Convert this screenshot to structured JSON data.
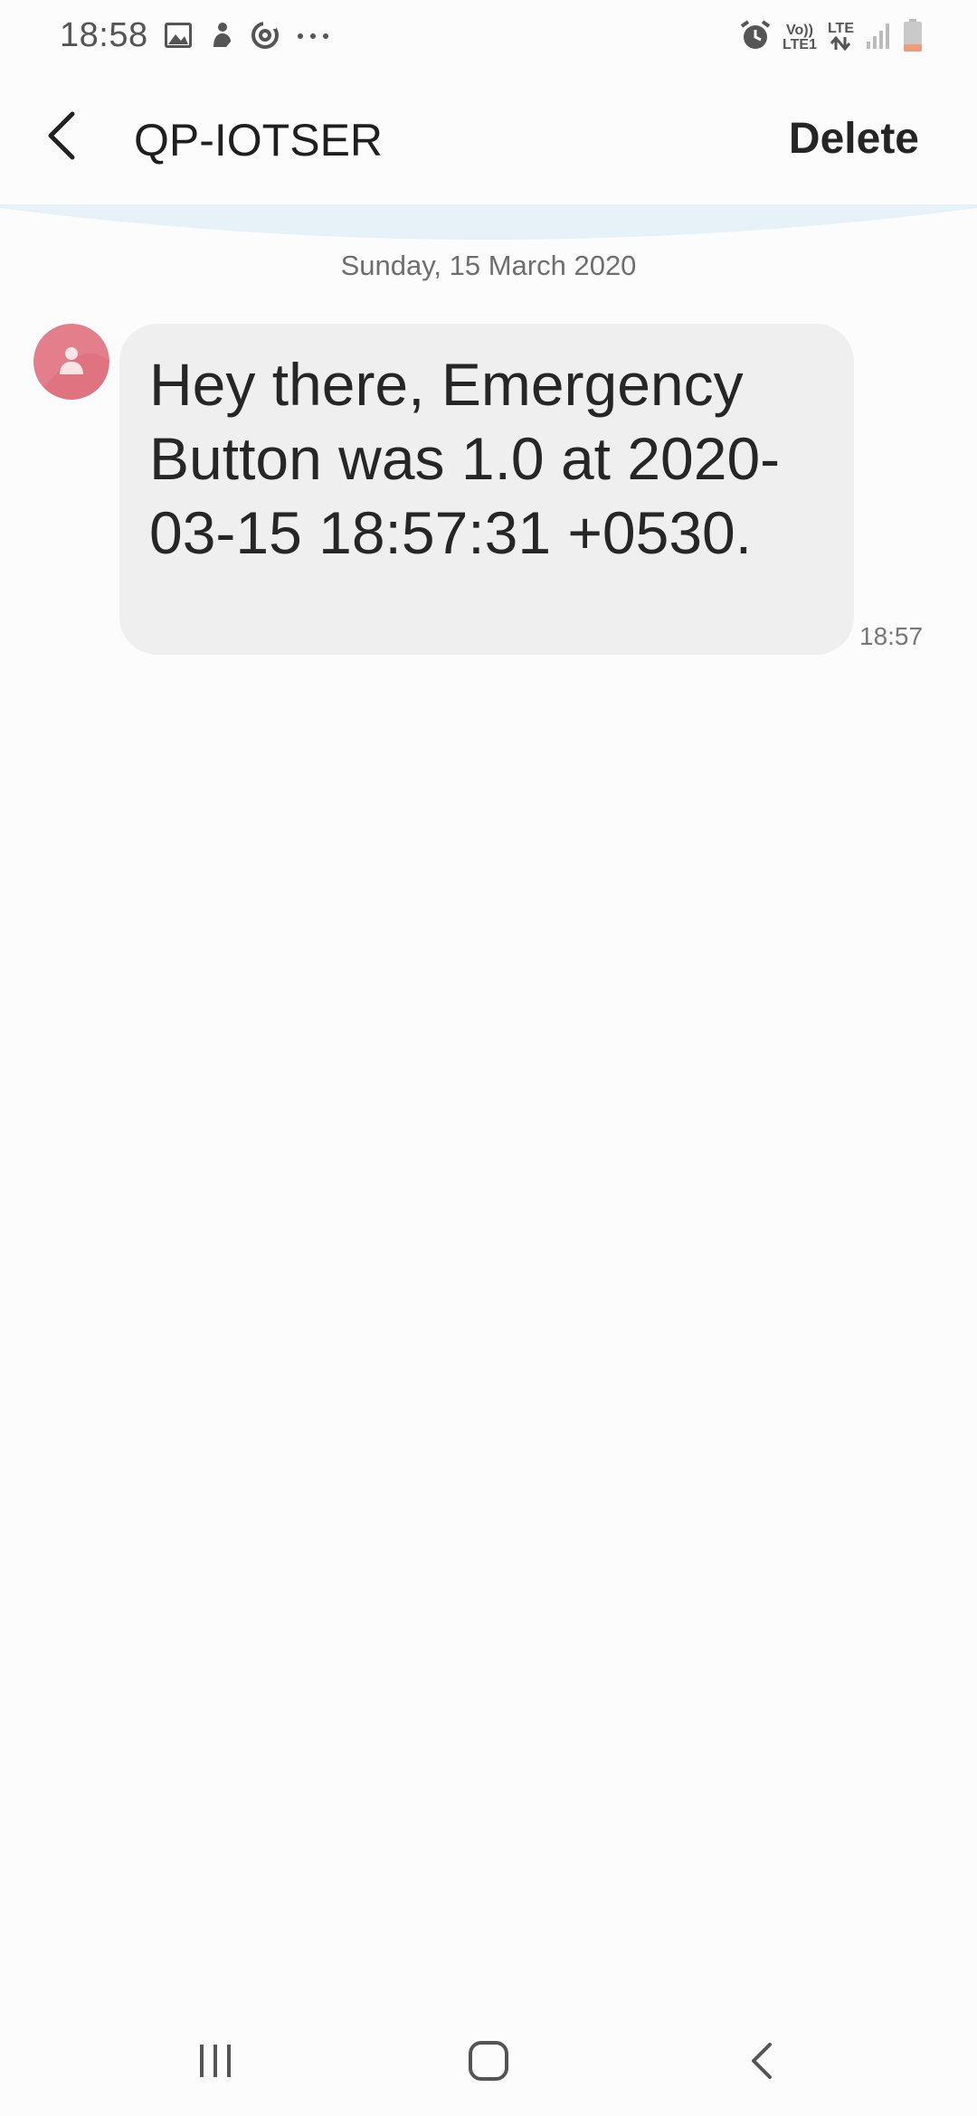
{
  "status_bar": {
    "time": "18:58",
    "left_icons": [
      "gallery-icon",
      "figure-icon",
      "sync-icon",
      "more-dots-icon"
    ],
    "network": {
      "volte_top": "Vo))",
      "volte_bottom": "LTE1",
      "lte_label": "LTE"
    },
    "right_icons": [
      "alarm-icon",
      "volte-icon",
      "lte-icon",
      "signal-icon",
      "battery-icon"
    ]
  },
  "app_bar": {
    "title": "QP-IOTSER",
    "delete_label": "Delete"
  },
  "conversation": {
    "date_header": "Sunday, 15 March 2020",
    "messages": [
      {
        "text": "Hey there, Emergency Button was 1.0 at 2020-03-15 18:57:31 +0530.",
        "time": "18:57"
      }
    ]
  },
  "colors": {
    "avatar": "#e07380",
    "bubble": "#efefef",
    "divider_arc": "#e6f1f8",
    "battery_low": "#f19a7a"
  },
  "nav_bar": {
    "buttons": [
      "recent-apps-icon",
      "home-icon",
      "back-nav-icon"
    ]
  }
}
